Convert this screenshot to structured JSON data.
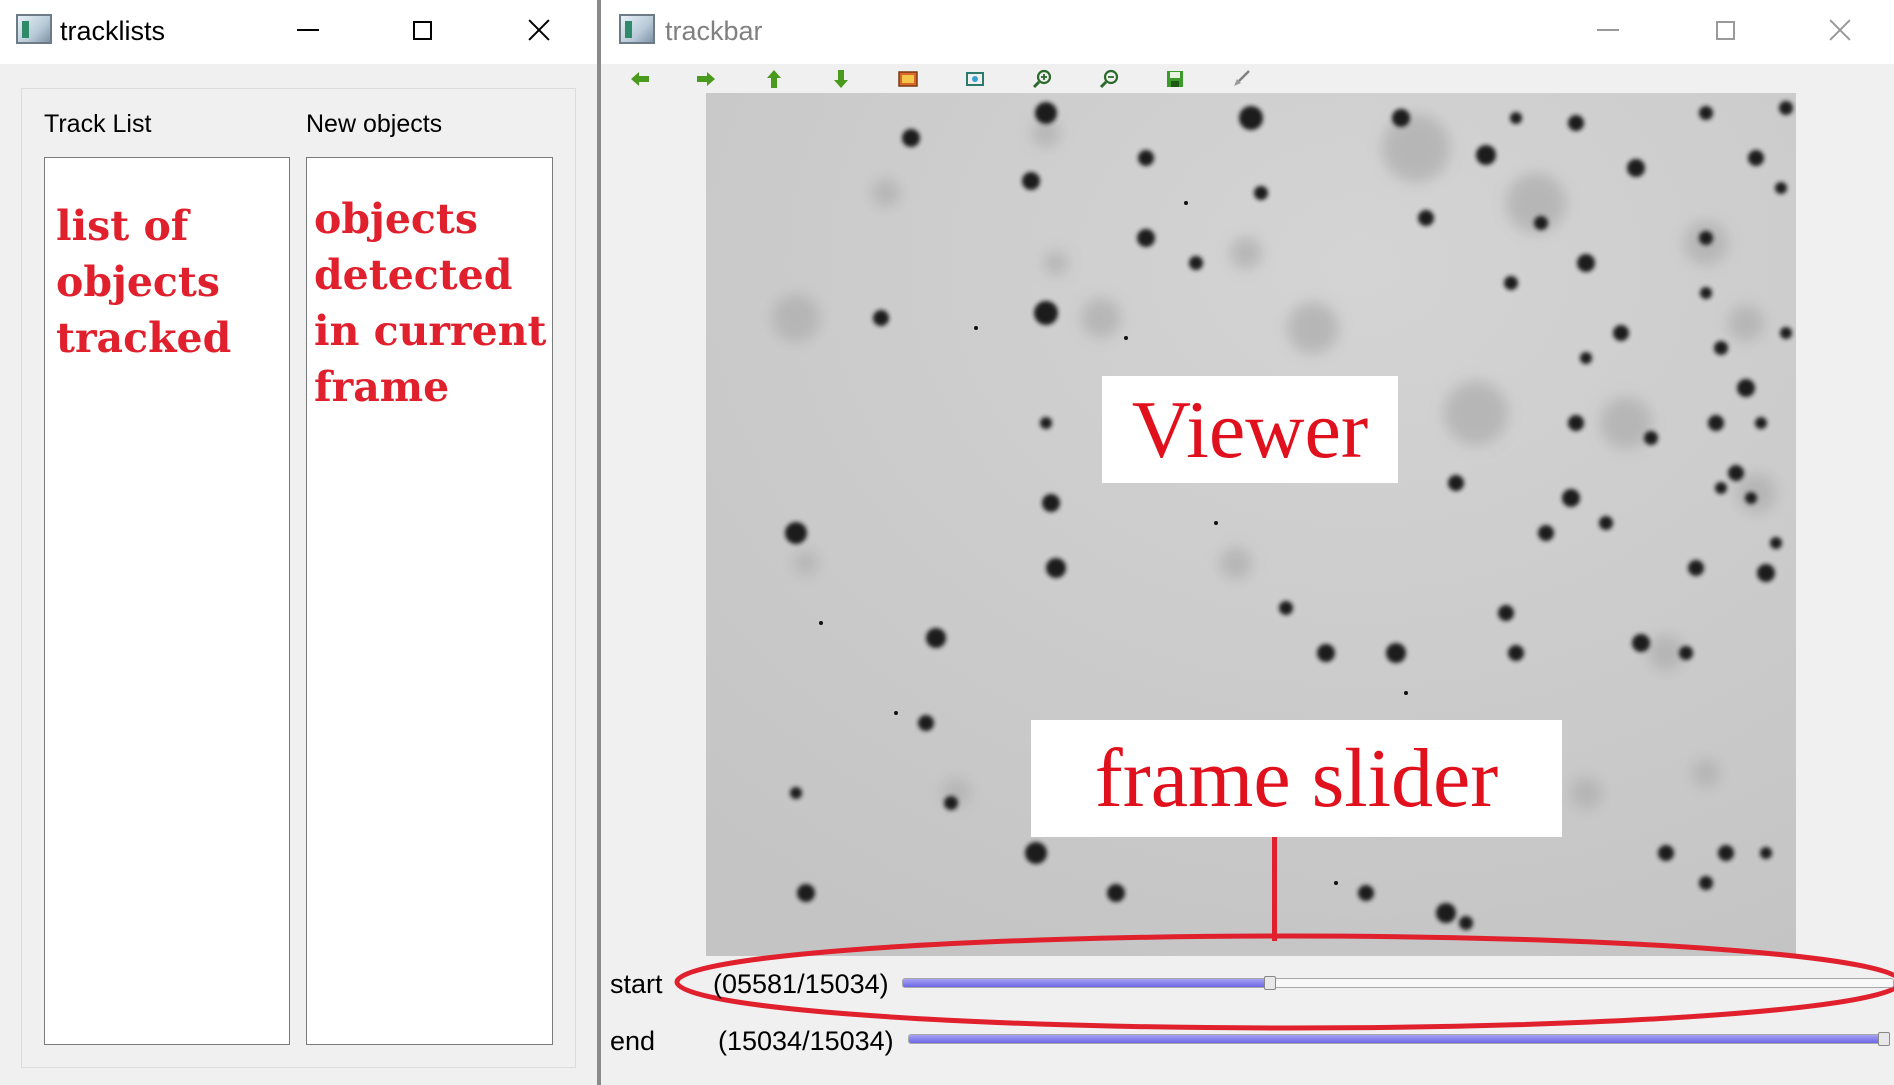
{
  "left_window": {
    "title": "tracklists",
    "icon": "app-window-icon",
    "track_list_label": "Track List",
    "new_objects_label": "New objects",
    "track_list_annotation": [
      "list of",
      "objects",
      "tracked"
    ],
    "new_objects_annotation": [
      "objects",
      "detected",
      "in current",
      "frame"
    ]
  },
  "right_window": {
    "title": "trackbar",
    "icon": "app-window-icon",
    "toolbar": [
      "arrow-left-icon",
      "arrow-right-icon",
      "arrow-up-icon",
      "arrow-down-icon",
      "image-icon",
      "zoom-fit-icon",
      "zoom-in-icon",
      "zoom-out-icon",
      "save-icon",
      "brush-icon"
    ],
    "viewer_label": "Viewer",
    "slider_annotation": "frame slider",
    "start_label": "start",
    "start_value": "(05581/15034)",
    "start_fraction": 0.371,
    "end_label": "end",
    "end_value": "(15034/15034)",
    "end_fraction": 1.0
  },
  "colors": {
    "annotation_red": "#e0202c",
    "slider_fill": "#6b66e6",
    "toolbar_green": "#4a9a1e"
  }
}
